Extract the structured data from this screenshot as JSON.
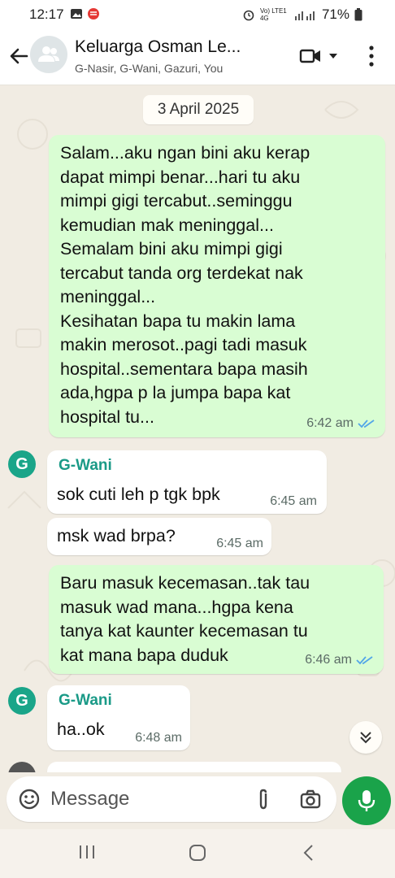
{
  "status_bar": {
    "time": "12:17",
    "network": "Vo) LTE1 4G",
    "battery": "71%"
  },
  "header": {
    "title": "Keluarga Osman Le...",
    "participants": "G-Nasir, G-Wani, Gazuri, You"
  },
  "chat": {
    "date_chip": "3 April 2025",
    "messages": [
      {
        "direction": "out",
        "text": "Salam...aku ngan bini aku kerap\ndapat mimpi benar...hari tu aku\nmimpi gigi tercabut..seminggu\nkemudian mak meninggal...\nSemalam bini aku mimpi gigi\ntercabut tanda org terdekat nak\nmeninggal...\nKesihatan bapa tu makin lama\nmakin merosot..pagi tadi masuk\nhospital..sementara bapa masih\nada,hgpa p la jumpa bapa kat\nhospital tu...",
        "time": "6:42 am",
        "read": true
      },
      {
        "direction": "in",
        "avatar": "G",
        "sender": "G-Wani",
        "text": "sok cuti leh p tgk bpk",
        "time": "6:45 am"
      },
      {
        "direction": "in",
        "text": "msk wad brpa?",
        "time": "6:45 am"
      },
      {
        "direction": "out",
        "text": "Baru masuk kecemasan..tak tau\nmasuk wad mana...hgpa kena\ntanya kat kaunter kecemasan tu\nkat mana bapa duduk",
        "time": "6:46 am",
        "read": true
      },
      {
        "direction": "in",
        "avatar": "G",
        "sender": "G-Wani",
        "text": "ha..ok",
        "time": "6:48 am"
      }
    ]
  },
  "input": {
    "placeholder": "Message"
  },
  "colors": {
    "outgoing_bubble": "#d9fdd3",
    "incoming_bubble": "#ffffff",
    "sender_name": "#1a9a87",
    "read_ticks": "#53a6e8",
    "mic_button": "#1aa34a",
    "wallpaper": "#f1ece3"
  },
  "icons": [
    "back-arrow-icon",
    "group-avatar-icon",
    "video-call-icon",
    "dropdown-icon",
    "more-vert-icon",
    "emoji-icon",
    "attach-icon",
    "camera-icon",
    "mic-icon",
    "scroll-down-icon"
  ]
}
